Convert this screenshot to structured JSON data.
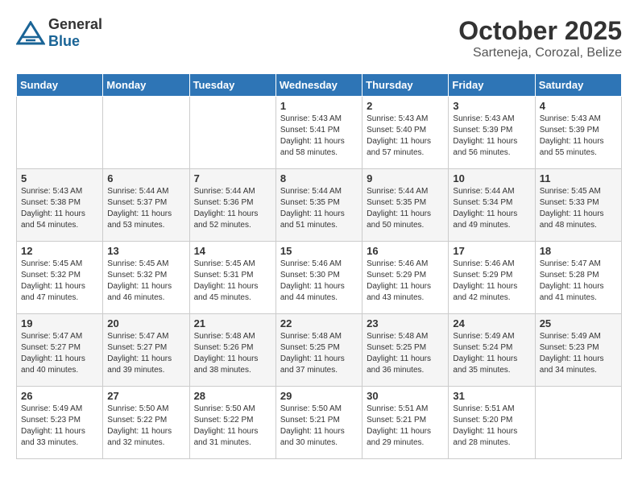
{
  "header": {
    "logo_general": "General",
    "logo_blue": "Blue",
    "title": "October 2025",
    "location": "Sarteneja, Corozal, Belize"
  },
  "weekdays": [
    "Sunday",
    "Monday",
    "Tuesday",
    "Wednesday",
    "Thursday",
    "Friday",
    "Saturday"
  ],
  "weeks": [
    [
      {
        "day": "",
        "info": ""
      },
      {
        "day": "",
        "info": ""
      },
      {
        "day": "",
        "info": ""
      },
      {
        "day": "1",
        "info": "Sunrise: 5:43 AM\nSunset: 5:41 PM\nDaylight: 11 hours\nand 58 minutes."
      },
      {
        "day": "2",
        "info": "Sunrise: 5:43 AM\nSunset: 5:40 PM\nDaylight: 11 hours\nand 57 minutes."
      },
      {
        "day": "3",
        "info": "Sunrise: 5:43 AM\nSunset: 5:39 PM\nDaylight: 11 hours\nand 56 minutes."
      },
      {
        "day": "4",
        "info": "Sunrise: 5:43 AM\nSunset: 5:39 PM\nDaylight: 11 hours\nand 55 minutes."
      }
    ],
    [
      {
        "day": "5",
        "info": "Sunrise: 5:43 AM\nSunset: 5:38 PM\nDaylight: 11 hours\nand 54 minutes."
      },
      {
        "day": "6",
        "info": "Sunrise: 5:44 AM\nSunset: 5:37 PM\nDaylight: 11 hours\nand 53 minutes."
      },
      {
        "day": "7",
        "info": "Sunrise: 5:44 AM\nSunset: 5:36 PM\nDaylight: 11 hours\nand 52 minutes."
      },
      {
        "day": "8",
        "info": "Sunrise: 5:44 AM\nSunset: 5:35 PM\nDaylight: 11 hours\nand 51 minutes."
      },
      {
        "day": "9",
        "info": "Sunrise: 5:44 AM\nSunset: 5:35 PM\nDaylight: 11 hours\nand 50 minutes."
      },
      {
        "day": "10",
        "info": "Sunrise: 5:44 AM\nSunset: 5:34 PM\nDaylight: 11 hours\nand 49 minutes."
      },
      {
        "day": "11",
        "info": "Sunrise: 5:45 AM\nSunset: 5:33 PM\nDaylight: 11 hours\nand 48 minutes."
      }
    ],
    [
      {
        "day": "12",
        "info": "Sunrise: 5:45 AM\nSunset: 5:32 PM\nDaylight: 11 hours\nand 47 minutes."
      },
      {
        "day": "13",
        "info": "Sunrise: 5:45 AM\nSunset: 5:32 PM\nDaylight: 11 hours\nand 46 minutes."
      },
      {
        "day": "14",
        "info": "Sunrise: 5:45 AM\nSunset: 5:31 PM\nDaylight: 11 hours\nand 45 minutes."
      },
      {
        "day": "15",
        "info": "Sunrise: 5:46 AM\nSunset: 5:30 PM\nDaylight: 11 hours\nand 44 minutes."
      },
      {
        "day": "16",
        "info": "Sunrise: 5:46 AM\nSunset: 5:29 PM\nDaylight: 11 hours\nand 43 minutes."
      },
      {
        "day": "17",
        "info": "Sunrise: 5:46 AM\nSunset: 5:29 PM\nDaylight: 11 hours\nand 42 minutes."
      },
      {
        "day": "18",
        "info": "Sunrise: 5:47 AM\nSunset: 5:28 PM\nDaylight: 11 hours\nand 41 minutes."
      }
    ],
    [
      {
        "day": "19",
        "info": "Sunrise: 5:47 AM\nSunset: 5:27 PM\nDaylight: 11 hours\nand 40 minutes."
      },
      {
        "day": "20",
        "info": "Sunrise: 5:47 AM\nSunset: 5:27 PM\nDaylight: 11 hours\nand 39 minutes."
      },
      {
        "day": "21",
        "info": "Sunrise: 5:48 AM\nSunset: 5:26 PM\nDaylight: 11 hours\nand 38 minutes."
      },
      {
        "day": "22",
        "info": "Sunrise: 5:48 AM\nSunset: 5:25 PM\nDaylight: 11 hours\nand 37 minutes."
      },
      {
        "day": "23",
        "info": "Sunrise: 5:48 AM\nSunset: 5:25 PM\nDaylight: 11 hours\nand 36 minutes."
      },
      {
        "day": "24",
        "info": "Sunrise: 5:49 AM\nSunset: 5:24 PM\nDaylight: 11 hours\nand 35 minutes."
      },
      {
        "day": "25",
        "info": "Sunrise: 5:49 AM\nSunset: 5:23 PM\nDaylight: 11 hours\nand 34 minutes."
      }
    ],
    [
      {
        "day": "26",
        "info": "Sunrise: 5:49 AM\nSunset: 5:23 PM\nDaylight: 11 hours\nand 33 minutes."
      },
      {
        "day": "27",
        "info": "Sunrise: 5:50 AM\nSunset: 5:22 PM\nDaylight: 11 hours\nand 32 minutes."
      },
      {
        "day": "28",
        "info": "Sunrise: 5:50 AM\nSunset: 5:22 PM\nDaylight: 11 hours\nand 31 minutes."
      },
      {
        "day": "29",
        "info": "Sunrise: 5:50 AM\nSunset: 5:21 PM\nDaylight: 11 hours\nand 30 minutes."
      },
      {
        "day": "30",
        "info": "Sunrise: 5:51 AM\nSunset: 5:21 PM\nDaylight: 11 hours\nand 29 minutes."
      },
      {
        "day": "31",
        "info": "Sunrise: 5:51 AM\nSunset: 5:20 PM\nDaylight: 11 hours\nand 28 minutes."
      },
      {
        "day": "",
        "info": ""
      }
    ]
  ]
}
